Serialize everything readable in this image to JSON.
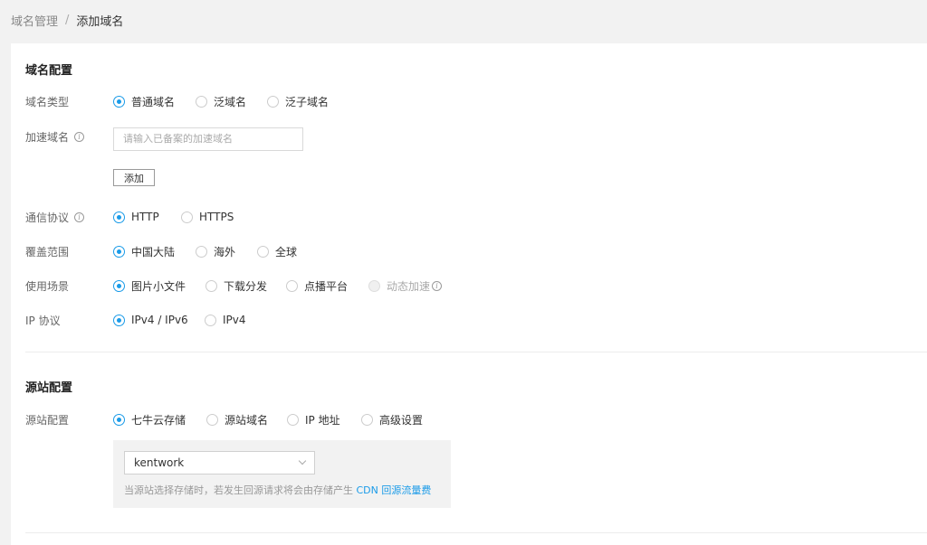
{
  "breadcrumb": {
    "parent": "域名管理",
    "separator": "/",
    "current": "添加域名"
  },
  "domain_section": {
    "title": "域名配置",
    "domain_type": {
      "label": "域名类型",
      "options": [
        "普通域名",
        "泛域名",
        "泛子域名"
      ],
      "selected": 0
    },
    "accel_domain": {
      "label": "加速域名",
      "placeholder": "请输入已备案的加速域名",
      "value": "",
      "add_label": "添加"
    },
    "protocol": {
      "label": "通信协议",
      "options": [
        "HTTP",
        "HTTPS"
      ],
      "selected": 0
    },
    "coverage": {
      "label": "覆盖范围",
      "options": [
        "中国大陆",
        "海外",
        "全球"
      ],
      "selected": 0
    },
    "scenario": {
      "label": "使用场景",
      "options": [
        "图片小文件",
        "下载分发",
        "点播平台",
        "动态加速"
      ],
      "selected": 0
    },
    "ip_protocol": {
      "label": "IP 协议",
      "options": [
        "IPv4 / IPv6",
        "IPv4"
      ],
      "selected": 0
    }
  },
  "origin_section": {
    "title": "源站配置",
    "origin": {
      "label": "源站配置",
      "options": [
        "七牛云存储",
        "源站域名",
        "IP 地址",
        "高级设置"
      ],
      "selected": 0
    },
    "bucket_value": "kentwork",
    "note_prefix": "当源站选择存储时，若发生回源请求将会由存储产生 ",
    "note_link": "CDN 回源流量费"
  },
  "colors": {
    "accent": "#1a9be8",
    "background": "#f2f2f2"
  }
}
